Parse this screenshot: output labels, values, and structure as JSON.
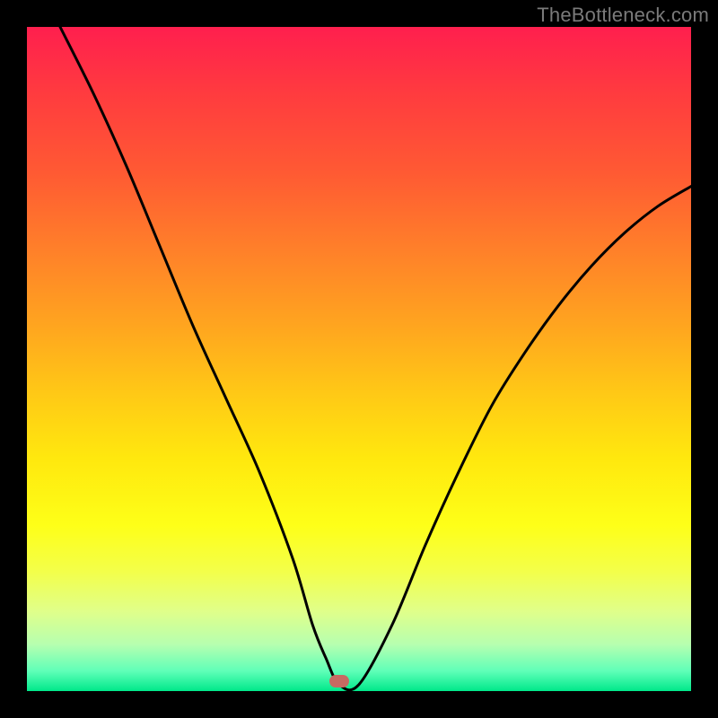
{
  "watermark": "TheBottleneck.com",
  "chart_data": {
    "type": "line",
    "title": "",
    "xlabel": "",
    "ylabel": "",
    "xlim": [
      0,
      100
    ],
    "ylim": [
      0,
      100
    ],
    "grid": false,
    "legend": false,
    "marker": {
      "x": 47,
      "y": 1.5
    },
    "series": [
      {
        "name": "curve",
        "x": [
          5,
          10,
          15,
          20,
          25,
          30,
          35,
          40,
          43,
          45,
          47,
          50,
          55,
          60,
          65,
          70,
          75,
          80,
          85,
          90,
          95,
          100
        ],
        "values": [
          100,
          90,
          79,
          67,
          55,
          44,
          33,
          20,
          10,
          5,
          1,
          1,
          10,
          22,
          33,
          43,
          51,
          58,
          64,
          69,
          73,
          76
        ]
      }
    ],
    "background_gradient": {
      "direction": "vertical",
      "stops": [
        {
          "pos": 0.0,
          "color": "#ff1f4e"
        },
        {
          "pos": 0.5,
          "color": "#ffc816"
        },
        {
          "pos": 0.8,
          "color": "#feff18"
        },
        {
          "pos": 1.0,
          "color": "#00e88a"
        }
      ]
    }
  }
}
